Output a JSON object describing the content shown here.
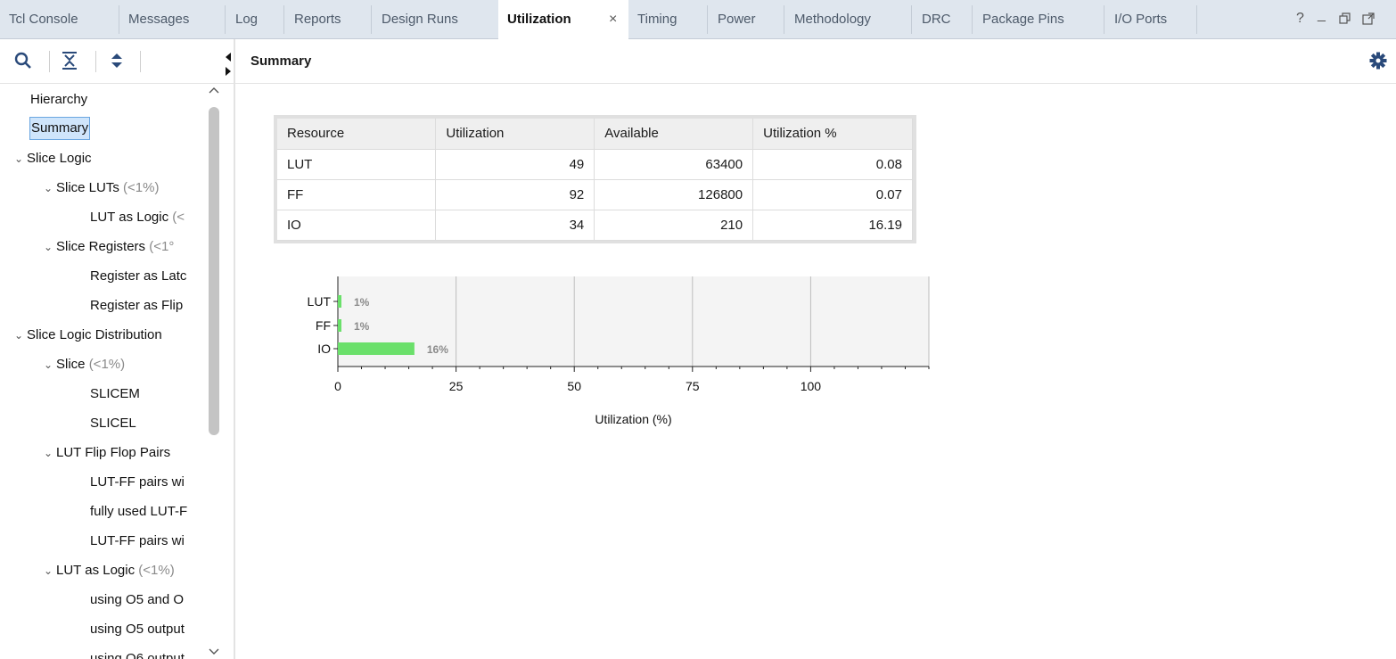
{
  "tabs": [
    {
      "label": "Tcl Console"
    },
    {
      "label": "Messages"
    },
    {
      "label": "Log"
    },
    {
      "label": "Reports"
    },
    {
      "label": "Design Runs"
    },
    {
      "label": "Utilization",
      "active": true,
      "close": "×"
    },
    {
      "label": "Timing"
    },
    {
      "label": "Power"
    },
    {
      "label": "Methodology"
    },
    {
      "label": "DRC"
    },
    {
      "label": "Package Pins"
    },
    {
      "label": "I/O Ports"
    }
  ],
  "window_controls": {
    "help": "?",
    "minimize": "_",
    "restore": "restore-icon",
    "float": "float-icon"
  },
  "toolbar_icons": [
    "search-icon",
    "collapse-all-icon",
    "expand-all-icon"
  ],
  "tree": [
    {
      "label": "Hierarchy",
      "pct": ""
    },
    {
      "label": "Summary",
      "pct": ""
    },
    {
      "label": "Slice Logic",
      "pct": "",
      "chev": "⌄"
    },
    {
      "label": "Slice LUTs",
      "pct": "(<1%)",
      "chev": "⌄"
    },
    {
      "label": "LUT as Logic",
      "pct": "(<",
      "chev": ""
    },
    {
      "label": "Slice Registers",
      "pct": "(<1°",
      "chev": "⌄"
    },
    {
      "label": "Register as Latc",
      "pct": "",
      "chev": ""
    },
    {
      "label": "Register as Flip",
      "pct": "",
      "chev": ""
    },
    {
      "label": "Slice Logic Distribution",
      "pct": "",
      "chev": "⌄"
    },
    {
      "label": "Slice",
      "pct": "(<1%)",
      "chev": "⌄"
    },
    {
      "label": "SLICEM",
      "pct": "",
      "chev": ""
    },
    {
      "label": "SLICEL",
      "pct": "",
      "chev": ""
    },
    {
      "label": "LUT Flip Flop Pairs",
      "pct": "",
      "chev": "⌄"
    },
    {
      "label": "LUT-FF pairs wi",
      "pct": "",
      "chev": ""
    },
    {
      "label": "fully used LUT-F",
      "pct": "",
      "chev": ""
    },
    {
      "label": "LUT-FF pairs wi",
      "pct": "",
      "chev": ""
    },
    {
      "label": "LUT as Logic",
      "pct": "(<1%)",
      "chev": "⌄"
    },
    {
      "label": "using O5 and O",
      "pct": "",
      "chev": ""
    },
    {
      "label": "using O5 output",
      "pct": "",
      "chev": ""
    },
    {
      "label": "using O6 output",
      "pct": "",
      "chev": ""
    }
  ],
  "summary": {
    "title": "Summary",
    "settings_icon": "gear-icon"
  },
  "table": {
    "headers": [
      "Resource",
      "Utilization",
      "Available",
      "Utilization %"
    ],
    "rows": [
      [
        "LUT",
        "49",
        "63400",
        "0.08"
      ],
      [
        "FF",
        "92",
        "126800",
        "0.07"
      ],
      [
        "IO",
        "34",
        "210",
        "16.19"
      ]
    ]
  },
  "chart_data": {
    "type": "bar",
    "orientation": "horizontal",
    "categories": [
      "LUT",
      "FF",
      "IO"
    ],
    "values": [
      0.08,
      0.07,
      16.19
    ],
    "data_labels": [
      "1%",
      "1%",
      "16%"
    ],
    "xlabel": "Utilization (%)",
    "ylabel": "",
    "xlim": [
      0,
      125
    ],
    "xticks": [
      0,
      25,
      50,
      75,
      100
    ],
    "grid": true,
    "bar_color": "#6be06b"
  },
  "colors": {
    "tabbar": "#dfe6ee",
    "selection": "#cfe5fb",
    "bar": "#6be06b"
  }
}
